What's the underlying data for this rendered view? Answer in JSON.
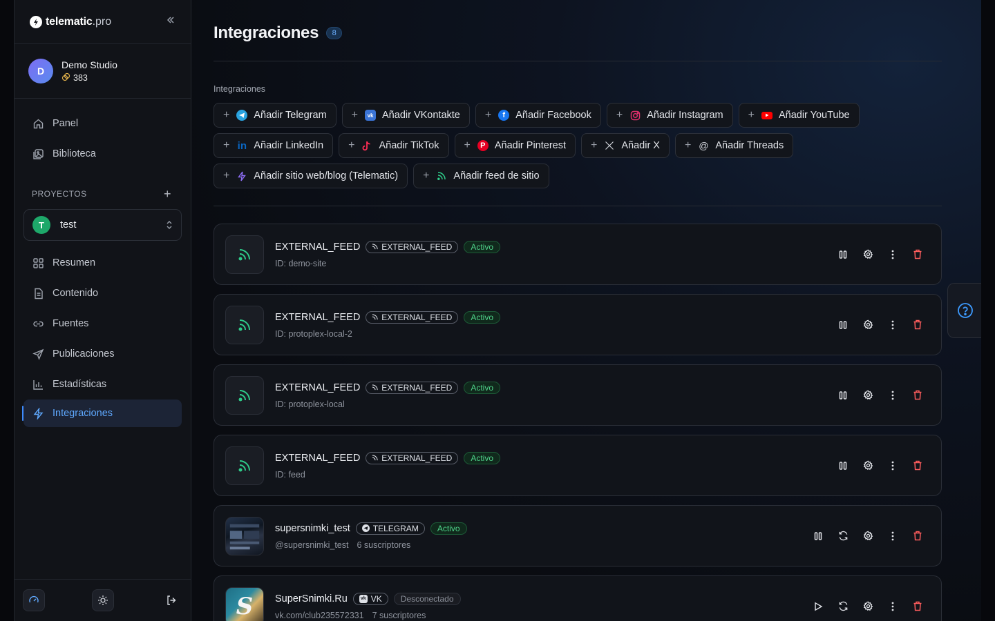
{
  "brand": {
    "name": "telematic",
    "suffix": ".pro"
  },
  "user": {
    "initial": "D",
    "name": "Demo Studio",
    "credits": "383"
  },
  "nav": {
    "panel": "Panel",
    "library": "Biblioteca"
  },
  "projects": {
    "label": "PROYECTOS",
    "selected_initial": "T",
    "selected_name": "test"
  },
  "project_nav": {
    "overview": "Resumen",
    "content": "Contenido",
    "sources": "Fuentes",
    "publications": "Publicaciones",
    "stats": "Estadísticas",
    "integrations": "Integraciones"
  },
  "page": {
    "title": "Integraciones",
    "count": "8",
    "section_label": "Integraciones"
  },
  "add_buttons": [
    {
      "label": "Añadir Telegram",
      "icon": "telegram-icon",
      "color": "#2aa3e0"
    },
    {
      "label": "Añadir VKontakte",
      "icon": "vk-icon",
      "color": "#3b74d6"
    },
    {
      "label": "Añadir Facebook",
      "icon": "facebook-icon",
      "color": "#1877f2"
    },
    {
      "label": "Añadir Instagram",
      "icon": "instagram-icon",
      "color": "#e1306c"
    },
    {
      "label": "Añadir YouTube",
      "icon": "youtube-icon",
      "color": "#ff0000"
    },
    {
      "label": "Añadir LinkedIn",
      "icon": "linkedin-icon",
      "color": "#0a66c2"
    },
    {
      "label": "Añadir TikTok",
      "icon": "tiktok-icon",
      "color": "#ff2d55"
    },
    {
      "label": "Añadir Pinterest",
      "icon": "pinterest-icon",
      "color": "#e60023"
    },
    {
      "label": "Añadir X",
      "icon": "x-icon",
      "color": "#cccccc"
    },
    {
      "label": "Añadir Threads",
      "icon": "threads-icon",
      "color": "#cccccc"
    },
    {
      "label": "Añadir sitio web/blog (Telematic)",
      "icon": "lightning-icon",
      "color": "#8b6cf2"
    },
    {
      "label": "Añadir feed de sitio",
      "icon": "rss-icon",
      "color": "#2ecc8a"
    }
  ],
  "integrations": [
    {
      "name": "EXTERNAL_FEED",
      "type": "EXTERNAL_FEED",
      "status": "Activo",
      "sub1": "ID: demo-site",
      "sub2": ""
    },
    {
      "name": "EXTERNAL_FEED",
      "type": "EXTERNAL_FEED",
      "status": "Activo",
      "sub1": "ID: protoplex-local-2",
      "sub2": ""
    },
    {
      "name": "EXTERNAL_FEED",
      "type": "EXTERNAL_FEED",
      "status": "Activo",
      "sub1": "ID: protoplex-local",
      "sub2": ""
    },
    {
      "name": "EXTERNAL_FEED",
      "type": "EXTERNAL_FEED",
      "status": "Activo",
      "sub1": "ID: feed",
      "sub2": ""
    },
    {
      "name": "supersnimki_test",
      "type": "TELEGRAM",
      "status": "Activo",
      "sub1": "@supersnimki_test",
      "sub2": "6 suscriptores"
    },
    {
      "name": "SuperSnimki.Ru",
      "type": "VK",
      "status": "Desconectado",
      "sub1": "vk.com/club235572331",
      "sub2": "7 suscriptores"
    }
  ],
  "colors": {
    "accent": "#3d8bfd",
    "active_green": "#4fd38a",
    "danger": "#ff5d5d"
  }
}
